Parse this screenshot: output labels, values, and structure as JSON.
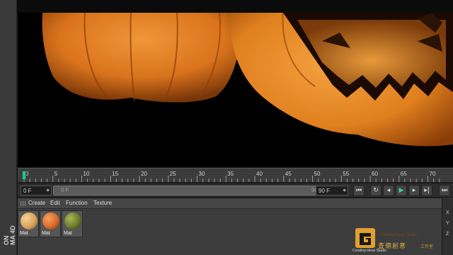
{
  "left_rail": {
    "brand_text": "ON",
    "brand_text2": "MA 4D"
  },
  "timeline": {
    "ticks": [
      "0",
      "5",
      "10",
      "15",
      "20",
      "25",
      "30",
      "35",
      "40",
      "45",
      "50",
      "55",
      "60",
      "65",
      "70"
    ],
    "current_frame": 0
  },
  "transport": {
    "current_field": "0 F",
    "range_start": "0 F",
    "range_end": "90 F",
    "end_field": "90 F",
    "buttons": [
      "go-to-start",
      "record",
      "step-back",
      "play",
      "step-forward",
      "go-to-end"
    ]
  },
  "material_manager": {
    "menu": [
      "Create",
      "Edit",
      "Function",
      "Texture"
    ],
    "materials": [
      {
        "name": "Mat",
        "color": "#d9a35a"
      },
      {
        "name": "Mat",
        "color": "#d86a2a"
      },
      {
        "name": "Mat",
        "color": "#6b7a2a"
      }
    ],
    "axes": [
      "X",
      "Y",
      "Z"
    ]
  },
  "watermark": {
    "cn": "査德創意",
    "cn_small": "工作室",
    "en": "Creating ideas Studio",
    "faint": "Creating Ideas · Studio"
  },
  "colors": {
    "accent": "#2fc08a",
    "viewport_bg": "#000000",
    "pumpkin": "#e07a1a"
  }
}
